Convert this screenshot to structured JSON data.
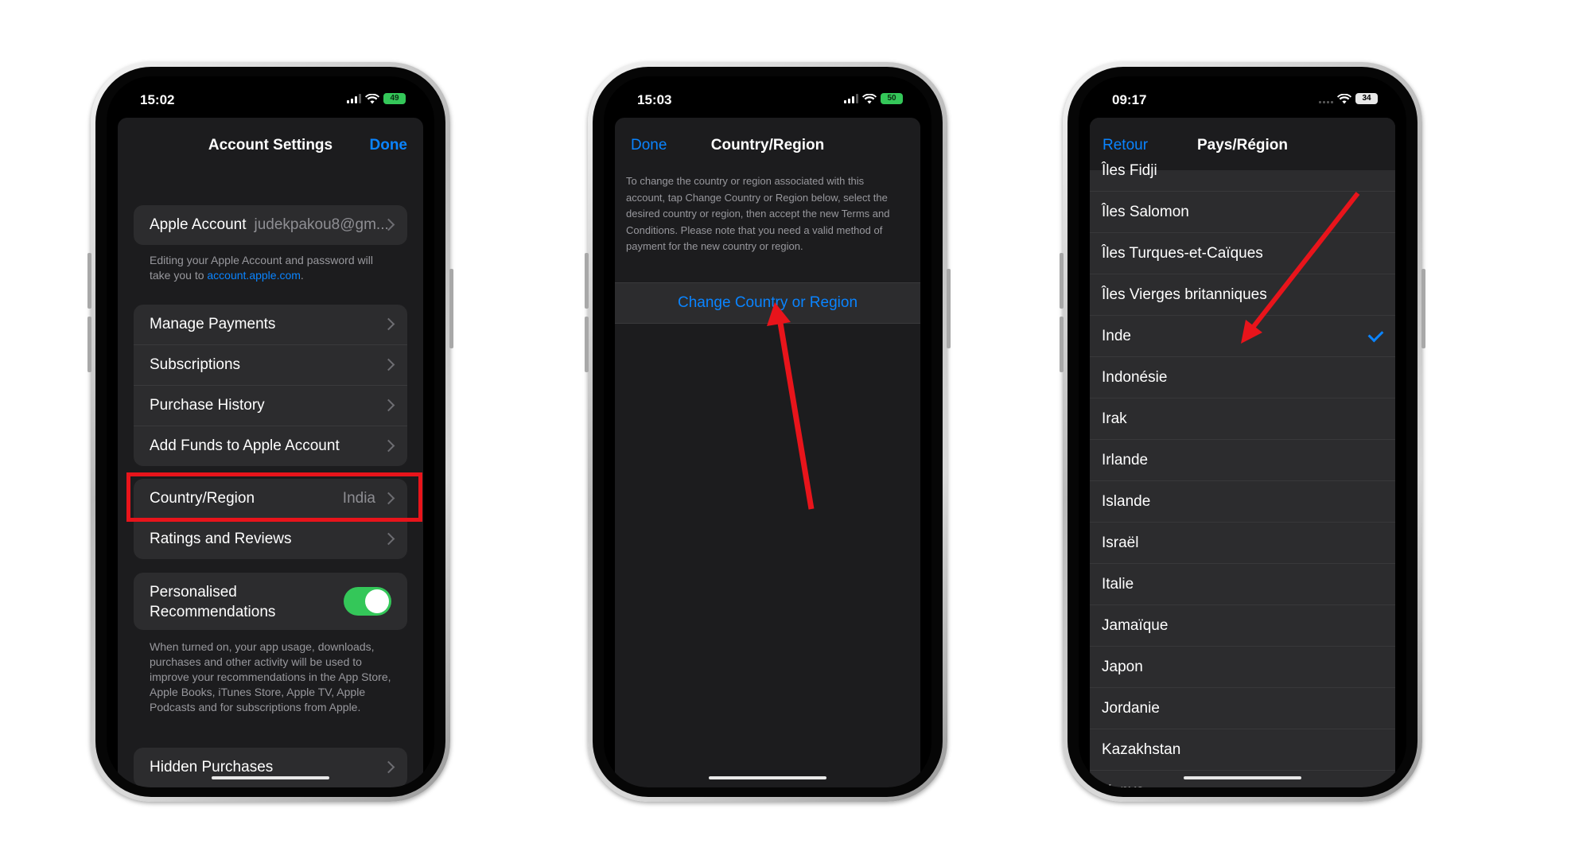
{
  "phone1": {
    "time": "15:02",
    "battery": "49",
    "title": "Account Settings",
    "done": "Done",
    "apple_account_label": "Apple Account",
    "apple_account_value": "judekpakou8@gm...",
    "apple_account_footer": "Editing your Apple Account and password will take you to",
    "apple_account_link": "account.apple.com",
    "apple_account_footer_end": ".",
    "group2": [
      "Manage Payments",
      "Subscriptions",
      "Purchase History",
      "Add Funds to Apple Account"
    ],
    "country_label": "Country/Region",
    "country_value": "India",
    "ratings": "Ratings and Reviews",
    "personalised": "Personalised Recommendations",
    "personalised_on": true,
    "personalised_footer": "When turned on, your app usage, downloads, purchases and other activity will be used to improve your recommendations in the App Store, Apple Books, iTunes Store, Apple TV, Apple Podcasts and for subscriptions from Apple.",
    "hidden": "Hidden Purchases"
  },
  "phone2": {
    "time": "15:03",
    "battery": "50",
    "done": "Done",
    "title": "Country/Region",
    "description": "To change the country or region associated with this account, tap Change Country or Region below, select the desired country or region, then accept the new Terms and Conditions. Please note that you need a valid method of payment for the new country or region.",
    "change_button": "Change Country or Region"
  },
  "phone3": {
    "time": "09:17",
    "battery": "34",
    "back": "Retour",
    "title": "Pays/Région",
    "countries": [
      "Îles Fidji",
      "Îles Salomon",
      "Îles Turques-et-Caïques",
      "Îles Vierges britanniques",
      "Inde",
      "Indonésie",
      "Irak",
      "Irlande",
      "Islande",
      "Israël",
      "Italie",
      "Jamaïque",
      "Japon",
      "Jordanie",
      "Kazakhstan",
      "Kenya"
    ],
    "selected": "Inde"
  },
  "colors": {
    "accent": "#0a84ff",
    "highlight": "#e8141b",
    "toggle_on": "#34c759",
    "background": "#1c1c1e"
  }
}
